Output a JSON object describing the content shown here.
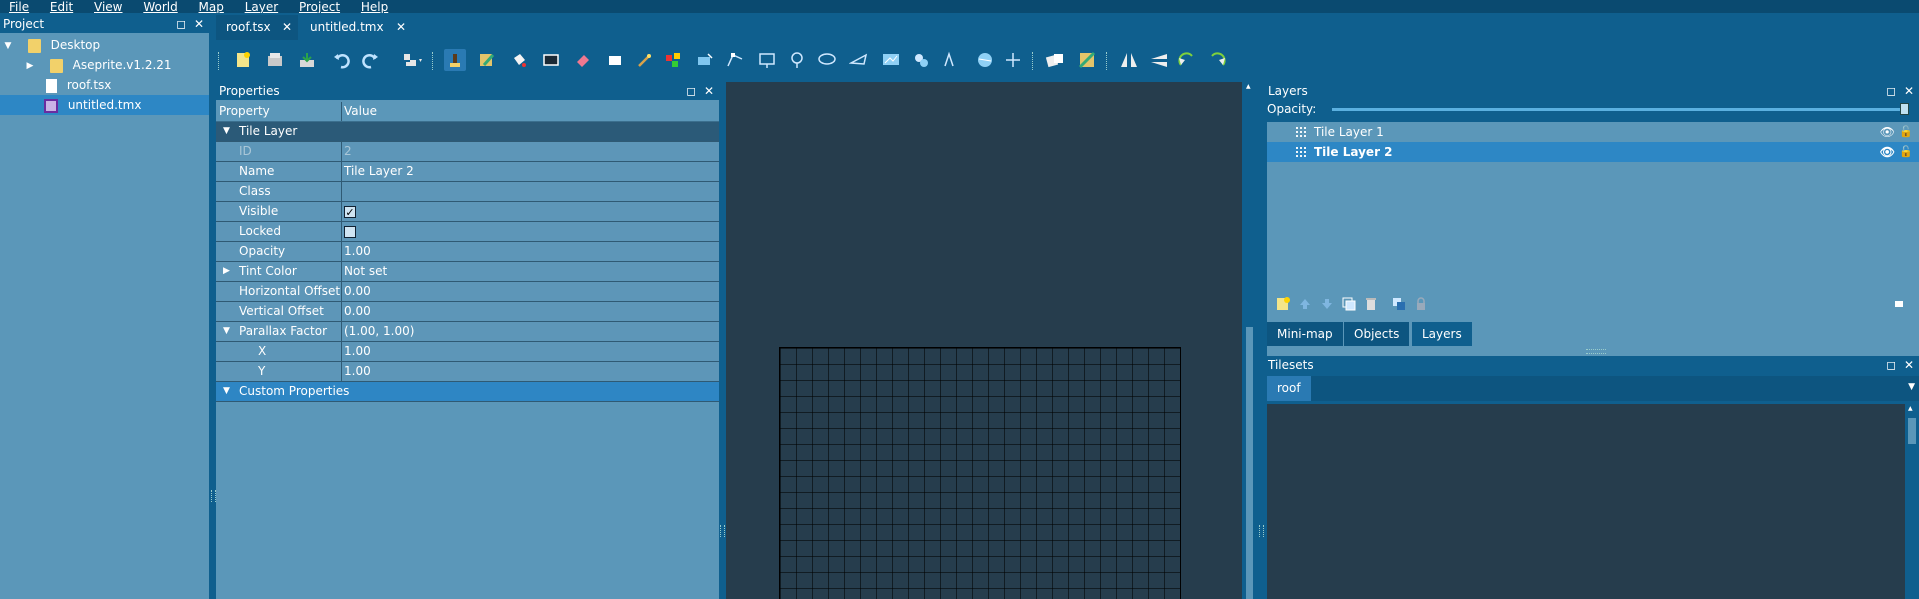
{
  "menu": [
    "File",
    "Edit",
    "View",
    "World",
    "Map",
    "Layer",
    "Project",
    "Help"
  ],
  "project": {
    "title": "Project",
    "items": [
      {
        "label": "Desktop"
      },
      {
        "label": "Aseprite.v1.2.21"
      },
      {
        "label": "roof.tsx"
      },
      {
        "label": "untitled.tmx"
      }
    ]
  },
  "tabs": [
    {
      "label": "roof.tsx",
      "close": "✕"
    },
    {
      "label": "untitled.tmx",
      "close": "✕"
    }
  ],
  "toolbar_icons": [
    "new-map-icon",
    "open-icon",
    "save-icon",
    "undo-icon",
    "redo-icon",
    "stamp-brush-icon",
    "terrain-brush-icon",
    "bucket-fill-icon",
    "shape-fill-icon",
    "eraser-icon",
    "rectangular-select-icon",
    "magic-wand-icon",
    "select-same-tile-icon",
    "select-objects-icon",
    "edit-polygons-icon",
    "insert-rectangle-icon",
    "insert-point-icon",
    "insert-ellipse-icon",
    "insert-polygon-icon",
    "insert-tile-icon",
    "insert-template-icon",
    "insert-text-icon",
    "world-tool-icon",
    "move-icon",
    "random-mode-icon",
    "wang-fill-icon",
    "flip-horizontal-icon",
    "flip-vertical-icon",
    "rotate-left-icon",
    "rotate-right-icon"
  ],
  "properties": {
    "title": "Properties",
    "col_property": "Property",
    "col_value": "Value",
    "group_label": "Tile Layer",
    "rows": [
      {
        "name": "ID",
        "value": "2"
      },
      {
        "name": "Name",
        "value": "Tile Layer 2"
      },
      {
        "name": "Class",
        "value": ""
      },
      {
        "name": "Visible",
        "value": "✓"
      },
      {
        "name": "Locked",
        "value": ""
      },
      {
        "name": "Opacity",
        "value": "1.00"
      },
      {
        "name": "Tint Color",
        "value": "Not set"
      },
      {
        "name": "Horizontal Offset",
        "value": "0.00"
      },
      {
        "name": "Vertical Offset",
        "value": "0.00"
      },
      {
        "name": "Parallax Factor",
        "value": "(1.00, 1.00)"
      },
      {
        "name": "X",
        "value": "1.00"
      },
      {
        "name": "Y",
        "value": "1.00"
      }
    ],
    "custom_label": "Custom Properties"
  },
  "layers": {
    "title": "Layers",
    "opacity_label": "Opacity:",
    "opacity_value": 1.0,
    "items": [
      {
        "label": "Tile Layer 1"
      },
      {
        "label": "Tile Layer 2"
      }
    ]
  },
  "bottom_tabs": [
    "Mini-map",
    "Objects",
    "Layers"
  ],
  "tilesets": {
    "title": "Tilesets",
    "tab": "roof"
  },
  "glyphs": {
    "float": "◻",
    "close": "✕",
    "expand": "▶",
    "collapse": "▼",
    "eye": "👁",
    "lock": "🔓"
  },
  "colors": {
    "chrome": "#0f5f8e",
    "panel": "#5b97b9",
    "selection": "#2d87c5",
    "canvas": "#263d4d"
  }
}
